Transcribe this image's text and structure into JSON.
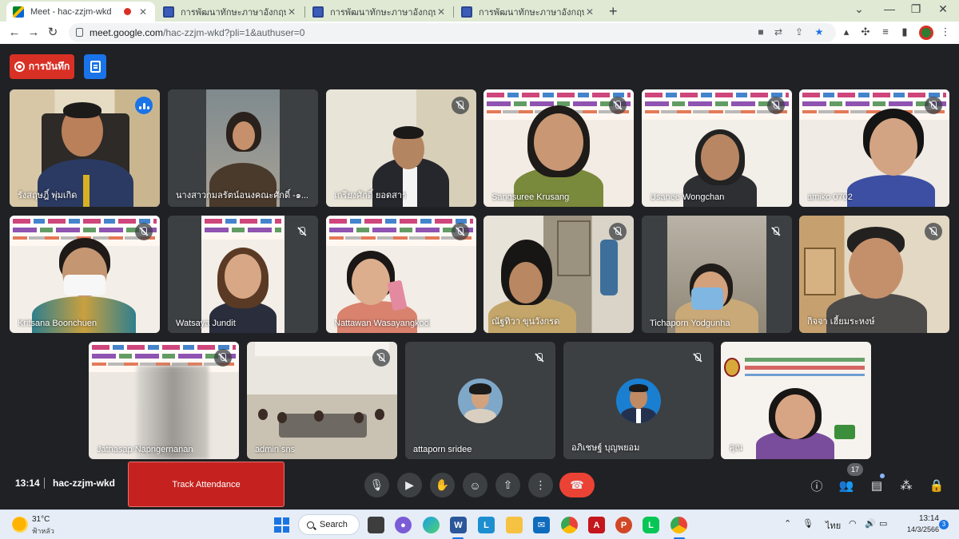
{
  "browser": {
    "tabs": [
      {
        "title": "Meet - hac-zzjm-wkd",
        "close": "✕"
      },
      {
        "title": "การพัฒนาทักษะภาษาอังกฤษ English",
        "close": "✕"
      },
      {
        "title": "การพัฒนาทักษะภาษาอังกฤษ English",
        "close": "✕"
      },
      {
        "title": "การพัฒนาทักษะภาษาอังกฤษ English",
        "close": "✕"
      }
    ],
    "new_tab": "+",
    "url_host": "meet.google.com",
    "url_path": "/hac-zzjm-wkd?pli=1&authuser=0"
  },
  "meet": {
    "record_label": "การบันทึก",
    "tiles": [
      {
        "name": "รังสฤษฎิ์ พุ่มเกิด",
        "muted": false,
        "speaking": true
      },
      {
        "name": "นางสาวกมลรัตน์อนงคณะศักดิ์ -๑...",
        "muted": false,
        "speaking": false
      },
      {
        "name": "เกรียงศักดิ์ ยอดสาร",
        "muted": true,
        "speaking": false
      },
      {
        "name": "Sangsuree Krusang",
        "muted": true,
        "speaking": false
      },
      {
        "name": "Usanee Wongchan",
        "muted": true,
        "speaking": false
      },
      {
        "name": "amiko 0702",
        "muted": true,
        "speaking": false
      },
      {
        "name": "Kritsana Boonchuen",
        "muted": true,
        "speaking": false
      },
      {
        "name": "Watsaya Jundit",
        "muted": true,
        "speaking": false
      },
      {
        "name": "Nattawan Wasayangkool",
        "muted": true,
        "speaking": false
      },
      {
        "name": "ณัฐทิวา ขุนวังกรด",
        "muted": true,
        "speaking": false
      },
      {
        "name": "Tichaporn Yodgunha",
        "muted": true,
        "speaking": false
      },
      {
        "name": "กิจจา เฮี้ยมระหงษ์",
        "muted": true,
        "speaking": false
      },
      {
        "name": "Jathasap Napngernanan",
        "muted": true,
        "speaking": false
      },
      {
        "name": "admin sns",
        "muted": true,
        "speaking": false
      },
      {
        "name": "attaporn sridee",
        "muted": true,
        "speaking": false
      },
      {
        "name": "อภิเชษฐ์ บุญพยอม",
        "muted": true,
        "speaking": false
      },
      {
        "name": "คุณ",
        "muted": false,
        "speaking": false
      }
    ],
    "time": "13:14",
    "meeting_code": "hac-zzjm-wkd",
    "track_attendance": "Track Attendance",
    "participant_count": "17"
  },
  "taskbar": {
    "temperature": "31°C",
    "weather": "ฟ้าหลัว",
    "search_label": "Search",
    "language": "ไทย",
    "clock_time": "13:14",
    "clock_date": "14/3/2566",
    "notification_count": "3"
  },
  "colors": {
    "meet_bg": "#202124",
    "record_red": "#d93025",
    "hangup_red": "#ea4335",
    "tabstrip_green": "#dfe9d3",
    "accent_blue": "#1a73e8"
  }
}
